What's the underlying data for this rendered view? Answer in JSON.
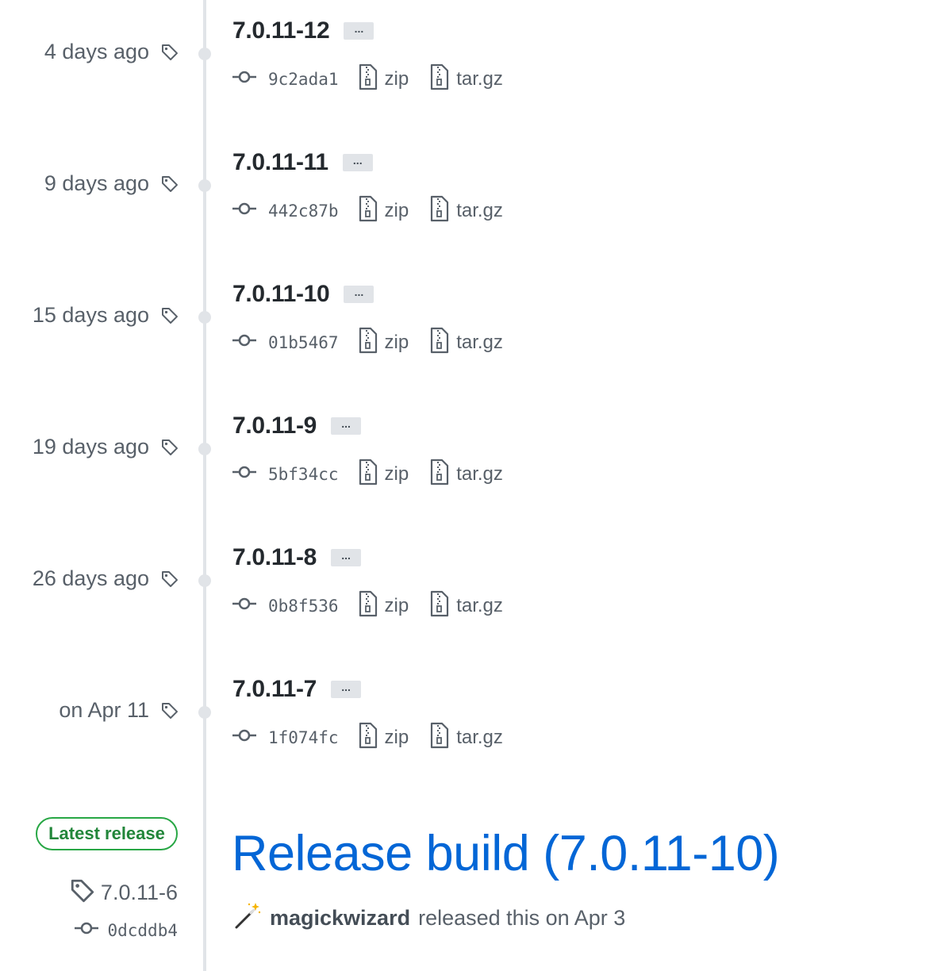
{
  "tags": [
    {
      "time": "4 days ago",
      "name": "7.0.11-12",
      "commit": "9c2ada1",
      "zip": "zip",
      "tar": "tar.gz",
      "more": "..."
    },
    {
      "time": "9 days ago",
      "name": "7.0.11-11",
      "commit": "442c87b",
      "zip": "zip",
      "tar": "tar.gz",
      "more": "..."
    },
    {
      "time": "15 days ago",
      "name": "7.0.11-10",
      "commit": "01b5467",
      "zip": "zip",
      "tar": "tar.gz",
      "more": "..."
    },
    {
      "time": "19 days ago",
      "name": "7.0.11-9",
      "commit": "5bf34cc",
      "zip": "zip",
      "tar": "tar.gz",
      "more": "..."
    },
    {
      "time": "26 days ago",
      "name": "7.0.11-8",
      "commit": "0b8f536",
      "zip": "zip",
      "tar": "tar.gz",
      "more": "..."
    },
    {
      "time": "on Apr 11",
      "name": "7.0.11-7",
      "commit": "1f074fc",
      "zip": "zip",
      "tar": "tar.gz",
      "more": "..."
    }
  ],
  "release": {
    "badge": "Latest release",
    "tag": "7.0.11-6",
    "commit": "0dcddb4",
    "title": "Release build (7.0.11-10)",
    "author": "magickwizard",
    "released_text": "released this on Apr 3",
    "author_icon": "magic-wand-icon"
  },
  "icons": {
    "tag": "tag-icon",
    "commit": "git-commit-icon",
    "file": "file-zip-icon"
  },
  "colors": {
    "link": "#0366d6",
    "muted": "#586069",
    "badge_green": "#28a745",
    "timeline": "#e1e4e8"
  }
}
